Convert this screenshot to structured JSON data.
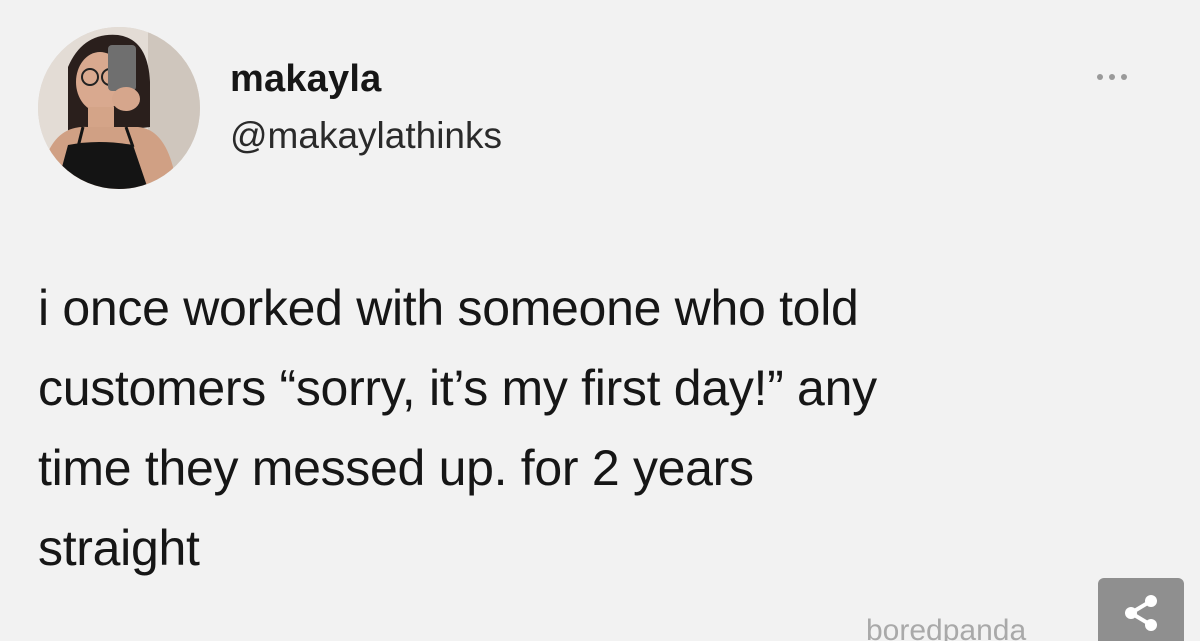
{
  "user": {
    "display_name": "makayla",
    "handle": "@makaylathinks"
  },
  "tweet": {
    "text": "i once worked with someone who told\ncustomers “sorry, it’s my first day!” any\ntime they messed up. for 2 years\nstraight"
  },
  "watermark": {
    "text": "boredpanda"
  },
  "icons": {
    "more": "more-dots-icon",
    "share": "share-icon"
  },
  "colors": {
    "background": "#f2f2f2",
    "text": "#161616",
    "share_button": "#8f8f8f"
  }
}
